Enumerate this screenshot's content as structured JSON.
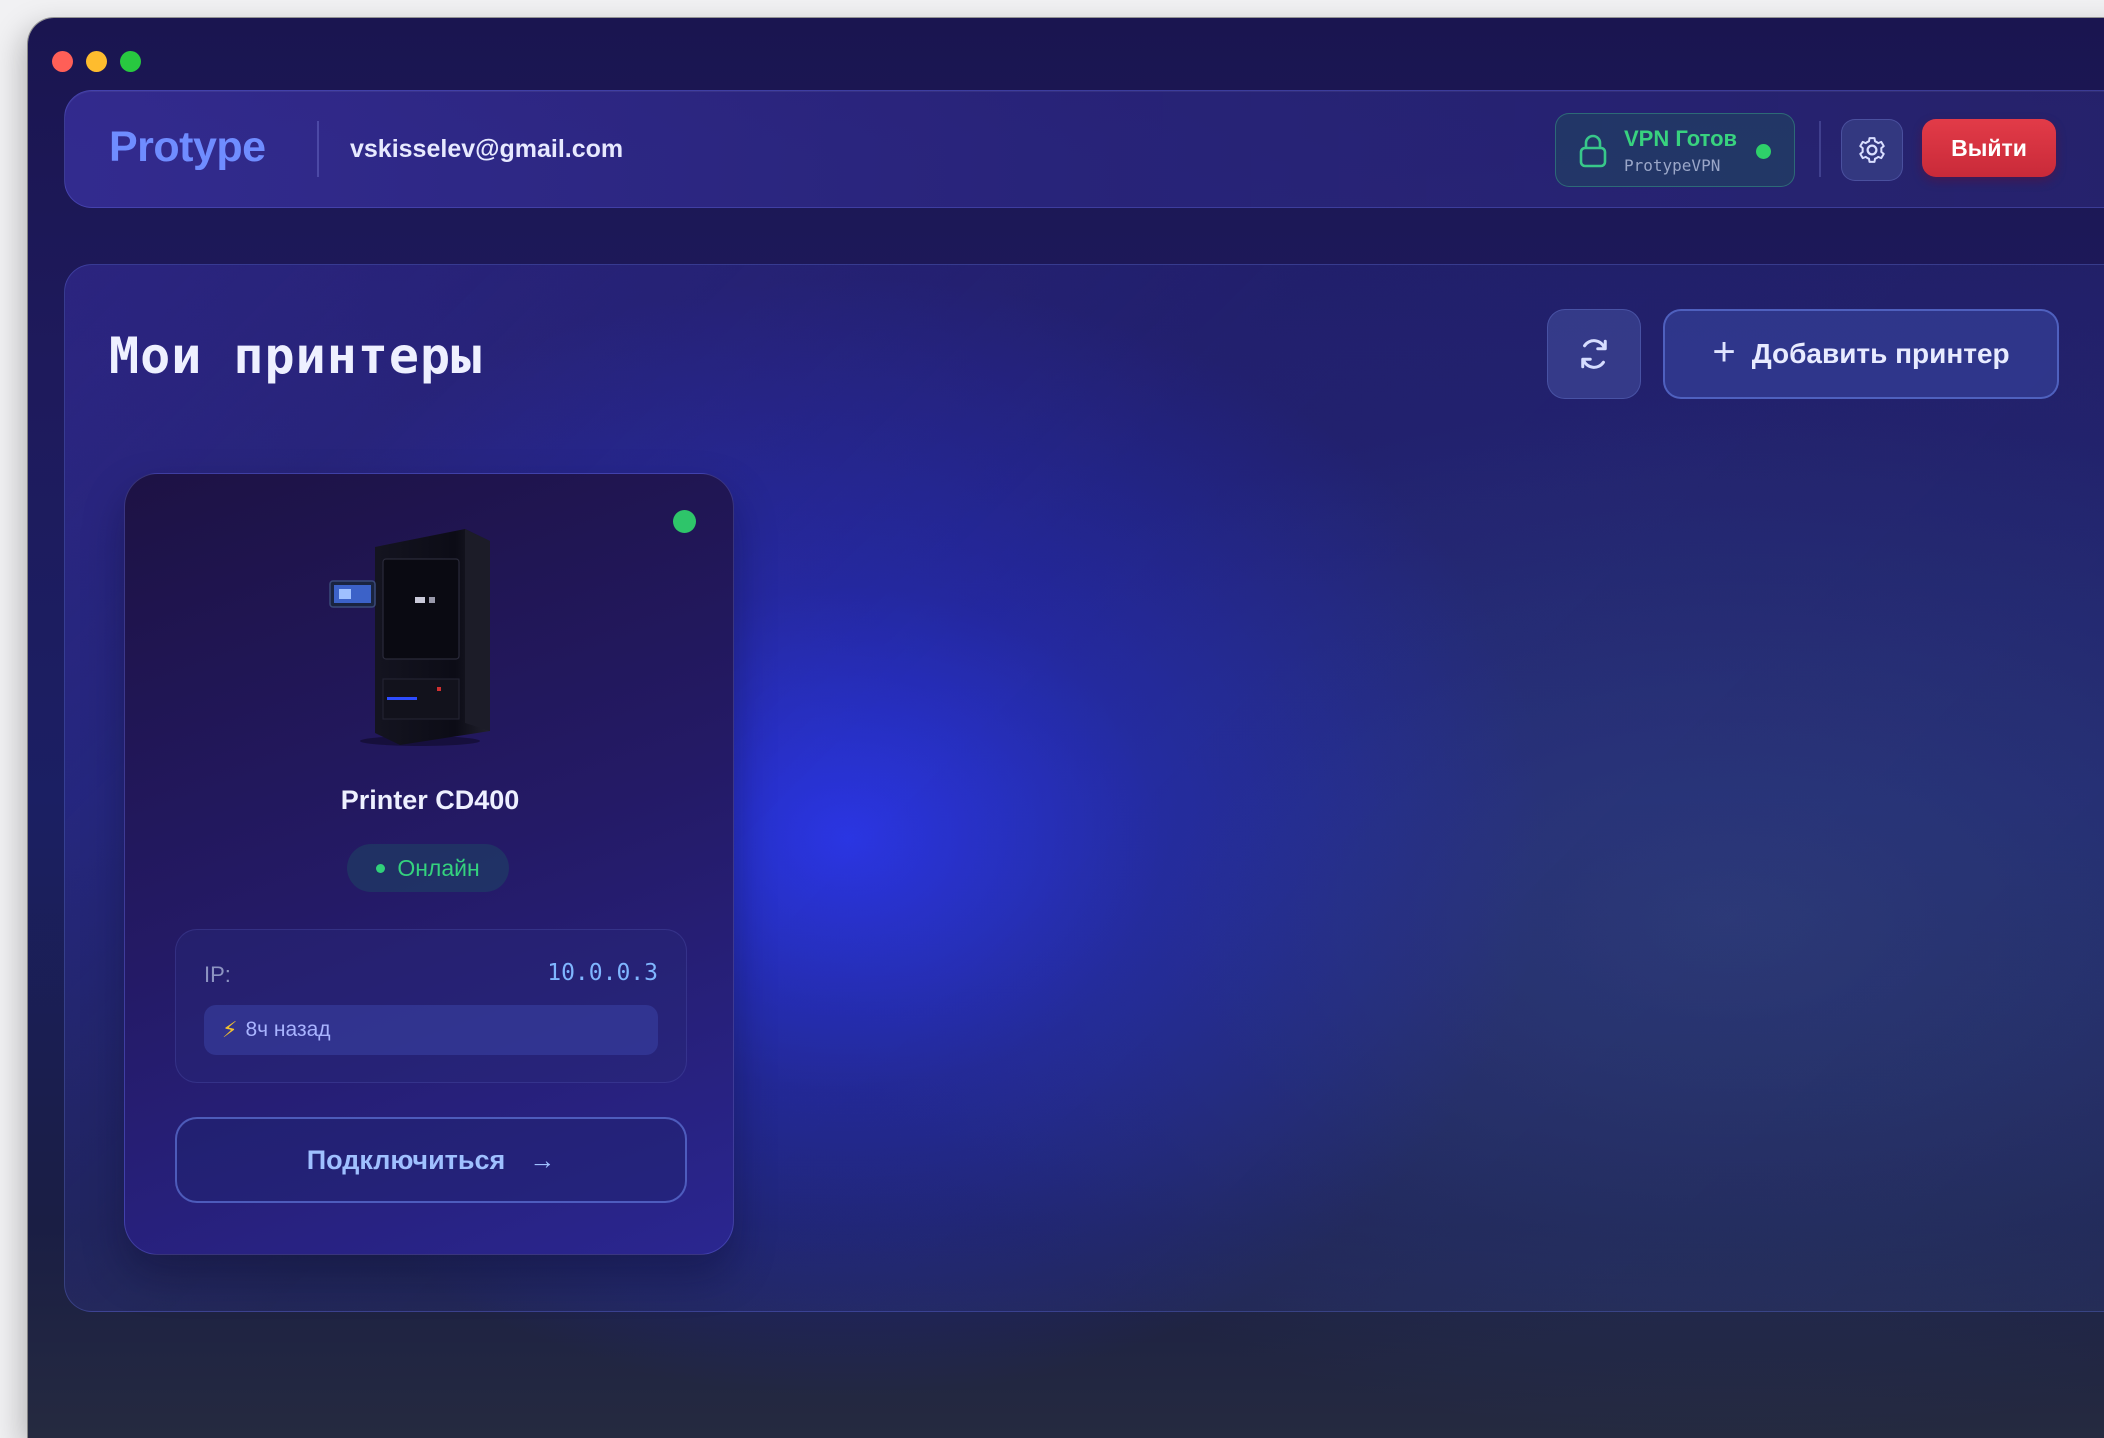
{
  "window": {
    "controls": [
      "close",
      "minimize",
      "zoom"
    ]
  },
  "header": {
    "brand": "Protype",
    "email": "vskisselev@gmail.com",
    "vpn": {
      "title": "VPN Готов",
      "subtitle": "ProtypeVPN",
      "icon": "lock-icon",
      "status_color": "#2ed06a"
    },
    "settings_icon": "gear-icon",
    "logout_label": "Выйти"
  },
  "main": {
    "title": "Мои принтеры",
    "refresh_icon": "refresh-icon",
    "add_printer_label": "Добавить принтер",
    "add_printer_icon": "+"
  },
  "printers": [
    {
      "name": "Printer CD400",
      "status": "Онлайн",
      "status_color": "#2ec56a",
      "ip_label": "IP:",
      "ip": "10.0.0.3",
      "last_seen": "8ч назад",
      "last_seen_icon": "⚡",
      "connect_label": "Подключиться",
      "connect_icon": "→"
    }
  ],
  "colors": {
    "accent": "#6f8cff",
    "danger": "#d83241",
    "online": "#30d07a"
  }
}
